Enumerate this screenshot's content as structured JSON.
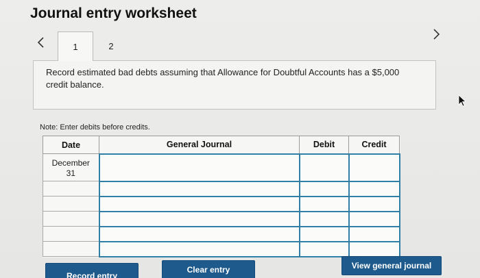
{
  "title": "Journal entry worksheet",
  "tabs": [
    {
      "label": "1"
    },
    {
      "label": "2"
    }
  ],
  "instruction": "Record estimated bad debts assuming that Allowance for Doubtful Accounts has a $5,000 credit balance.",
  "note": "Note: Enter debits before credits.",
  "table": {
    "headers": {
      "date": "Date",
      "general_journal": "General Journal",
      "debit": "Debit",
      "credit": "Credit"
    },
    "date_month": "December",
    "date_day": "31"
  },
  "buttons": {
    "record": "Record entry",
    "clear": "Clear entry",
    "view": "View general journal"
  },
  "icons": {
    "prev": "chevron-left-icon",
    "next": "chevron-right-icon"
  },
  "colors": {
    "button_blue": "#1e5a8c",
    "input_border": "#2f7fa6"
  }
}
